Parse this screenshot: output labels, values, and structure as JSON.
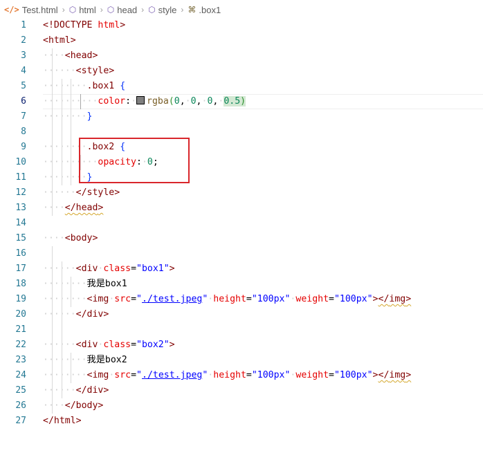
{
  "breadcrumb": [
    {
      "label": "Test.html",
      "icon": "html-file-icon"
    },
    {
      "label": "html",
      "icon": "element-cube-icon"
    },
    {
      "label": "head",
      "icon": "element-cube-icon"
    },
    {
      "label": "style",
      "icon": "element-cube-icon"
    },
    {
      "label": ".box1",
      "icon": "css-selector-icon"
    }
  ],
  "active_line": 6,
  "lines": [
    {
      "n": "1",
      "tokens": [
        [
          "<!DOCTYPE",
          "t-pun"
        ],
        [
          " ",
          "ws"
        ],
        [
          "html",
          "t-attr"
        ],
        [
          ">",
          "t-pun"
        ]
      ]
    },
    {
      "n": "2",
      "tokens": [
        [
          "<",
          "t-pun"
        ],
        [
          "html",
          "t-tag"
        ],
        [
          ">",
          "t-pun"
        ]
      ]
    },
    {
      "n": "3",
      "tokens": [
        [
          "····",
          "ws"
        ],
        [
          "<",
          "t-pun"
        ],
        [
          "head",
          "t-tag"
        ],
        [
          ">",
          "t-pun"
        ]
      ]
    },
    {
      "n": "4",
      "tokens": [
        [
          "······",
          "ws"
        ],
        [
          "<",
          "t-pun"
        ],
        [
          "style",
          "t-tag"
        ],
        [
          ">",
          "t-pun"
        ]
      ]
    },
    {
      "n": "5",
      "tokens": [
        [
          "········",
          "ws"
        ],
        [
          ".box1",
          "t-sel"
        ],
        [
          " ",
          "ws"
        ],
        [
          "{",
          "t-brace"
        ]
      ]
    },
    {
      "n": "6",
      "tokens": [
        [
          "··········",
          "ws"
        ],
        [
          "color",
          "t-prop"
        ],
        [
          ":",
          "t-txt"
        ],
        [
          "·",
          "ws"
        ],
        [
          "SWATCH",
          "swatch"
        ],
        [
          "rgba",
          "t-fn"
        ],
        [
          "(",
          "t-br"
        ],
        [
          "0",
          "t-num"
        ],
        [
          ",",
          "t-txt"
        ],
        [
          "·",
          "ws"
        ],
        [
          "0",
          "t-num"
        ],
        [
          ",",
          "t-txt"
        ],
        [
          "·",
          "ws"
        ],
        [
          "0",
          "t-num"
        ],
        [
          ",",
          "t-txt"
        ],
        [
          "·",
          "ws"
        ],
        [
          "0.5",
          "t-num hl"
        ],
        [
          ")",
          "t-br hl"
        ]
      ]
    },
    {
      "n": "7",
      "tokens": [
        [
          "········",
          "ws"
        ],
        [
          "}",
          "t-brace"
        ]
      ]
    },
    {
      "n": "8",
      "tokens": []
    },
    {
      "n": "9",
      "tokens": [
        [
          "········",
          "ws"
        ],
        [
          ".box2",
          "t-sel"
        ],
        [
          " ",
          "ws"
        ],
        [
          "{",
          "t-brace"
        ]
      ]
    },
    {
      "n": "10",
      "tokens": [
        [
          "··········",
          "ws"
        ],
        [
          "opacity",
          "t-prop"
        ],
        [
          ":",
          "t-txt"
        ],
        [
          "·",
          "ws"
        ],
        [
          "0",
          "t-num"
        ],
        [
          ";",
          "t-txt"
        ]
      ]
    },
    {
      "n": "11",
      "tokens": [
        [
          "········",
          "ws"
        ],
        [
          "}",
          "t-brace"
        ]
      ]
    },
    {
      "n": "12",
      "tokens": [
        [
          "······",
          "ws"
        ],
        [
          "</",
          "t-pun"
        ],
        [
          "style",
          "t-tag"
        ],
        [
          ">",
          "t-pun"
        ]
      ]
    },
    {
      "n": "13",
      "tokens": [
        [
          "····",
          "ws"
        ],
        [
          "</",
          "t-pun squig"
        ],
        [
          "head",
          "t-tag squig"
        ],
        [
          ">",
          "t-pun squig"
        ]
      ]
    },
    {
      "n": "14",
      "tokens": []
    },
    {
      "n": "15",
      "tokens": [
        [
          "····",
          "ws"
        ],
        [
          "<",
          "t-pun"
        ],
        [
          "body",
          "t-tag"
        ],
        [
          ">",
          "t-pun"
        ]
      ]
    },
    {
      "n": "16",
      "tokens": []
    },
    {
      "n": "17",
      "tokens": [
        [
          "······",
          "ws"
        ],
        [
          "<",
          "t-pun"
        ],
        [
          "div",
          "t-tag"
        ],
        [
          "·",
          "ws"
        ],
        [
          "class",
          "t-attr"
        ],
        [
          "=",
          "t-txt"
        ],
        [
          "\"box1\"",
          "t-str"
        ],
        [
          ">",
          "t-pun"
        ]
      ]
    },
    {
      "n": "18",
      "tokens": [
        [
          "········",
          "ws"
        ],
        [
          "我是",
          "t-txt cjk"
        ],
        [
          "box1",
          "t-txt"
        ]
      ]
    },
    {
      "n": "19",
      "tokens": [
        [
          "········",
          "ws"
        ],
        [
          "<",
          "t-pun"
        ],
        [
          "img",
          "t-tag"
        ],
        [
          "·",
          "ws"
        ],
        [
          "src",
          "t-attr"
        ],
        [
          "=",
          "t-txt"
        ],
        [
          "\"",
          "t-str"
        ],
        [
          "./test.jpeg",
          "t-str link"
        ],
        [
          "\"",
          "t-str"
        ],
        [
          "·",
          "ws"
        ],
        [
          "height",
          "t-attr"
        ],
        [
          "=",
          "t-txt"
        ],
        [
          "\"100px\"",
          "t-str"
        ],
        [
          "·",
          "ws"
        ],
        [
          "weight",
          "t-attr"
        ],
        [
          "=",
          "t-txt"
        ],
        [
          "\"100px\"",
          "t-str"
        ],
        [
          ">",
          "t-pun"
        ],
        [
          "</",
          "t-pun squig"
        ],
        [
          "img",
          "t-tag squig"
        ],
        [
          ">",
          "t-pun squig"
        ]
      ]
    },
    {
      "n": "20",
      "tokens": [
        [
          "······",
          "ws"
        ],
        [
          "</",
          "t-pun"
        ],
        [
          "div",
          "t-tag"
        ],
        [
          ">",
          "t-pun"
        ]
      ]
    },
    {
      "n": "21",
      "tokens": []
    },
    {
      "n": "22",
      "tokens": [
        [
          "······",
          "ws"
        ],
        [
          "<",
          "t-pun"
        ],
        [
          "div",
          "t-tag"
        ],
        [
          "·",
          "ws"
        ],
        [
          "class",
          "t-attr"
        ],
        [
          "=",
          "t-txt"
        ],
        [
          "\"box2\"",
          "t-str"
        ],
        [
          ">",
          "t-pun"
        ]
      ]
    },
    {
      "n": "23",
      "tokens": [
        [
          "········",
          "ws"
        ],
        [
          "我是",
          "t-txt cjk"
        ],
        [
          "box2",
          "t-txt"
        ]
      ]
    },
    {
      "n": "24",
      "tokens": [
        [
          "········",
          "ws"
        ],
        [
          "<",
          "t-pun"
        ],
        [
          "img",
          "t-tag"
        ],
        [
          "·",
          "ws"
        ],
        [
          "src",
          "t-attr"
        ],
        [
          "=",
          "t-txt"
        ],
        [
          "\"",
          "t-str"
        ],
        [
          "./test.jpeg",
          "t-str link"
        ],
        [
          "\"",
          "t-str"
        ],
        [
          "·",
          "ws"
        ],
        [
          "height",
          "t-attr"
        ],
        [
          "=",
          "t-txt"
        ],
        [
          "\"100px\"",
          "t-str"
        ],
        [
          "·",
          "ws"
        ],
        [
          "weight",
          "t-attr"
        ],
        [
          "=",
          "t-txt"
        ],
        [
          "\"100px\"",
          "t-str"
        ],
        [
          ">",
          "t-pun"
        ],
        [
          "</",
          "t-pun squig"
        ],
        [
          "img",
          "t-tag squig"
        ],
        [
          ">",
          "t-pun squig"
        ]
      ]
    },
    {
      "n": "25",
      "tokens": [
        [
          "······",
          "ws"
        ],
        [
          "</",
          "t-pun"
        ],
        [
          "div",
          "t-tag"
        ],
        [
          ">",
          "t-pun"
        ]
      ]
    },
    {
      "n": "26",
      "tokens": [
        [
          "····",
          "ws"
        ],
        [
          "</",
          "t-pun"
        ],
        [
          "body",
          "t-tag"
        ],
        [
          ">",
          "t-pun"
        ]
      ]
    },
    {
      "n": "27",
      "tokens": [
        [
          "</",
          "t-pun"
        ],
        [
          "html",
          "t-tag"
        ],
        [
          ">",
          "t-pun"
        ]
      ]
    }
  ],
  "highlight_annotation": {
    "color": "#d9262b",
    "lines": [
      9,
      11
    ]
  },
  "colors": {
    "tag": "#800000",
    "attribute": "#e50000",
    "string": "#0000ff",
    "number": "#098658",
    "line_number": "#237893",
    "annotation": "#d9262b"
  }
}
